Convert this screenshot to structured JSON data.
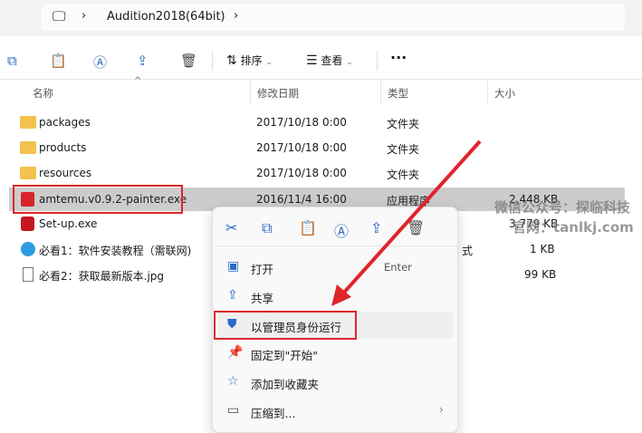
{
  "address": {
    "path": "Audition2018(64bit)"
  },
  "toolbar": {
    "sort": "排序",
    "view": "查看",
    "more": "···"
  },
  "columns": {
    "name": "名称",
    "date": "修改日期",
    "type": "类型",
    "size": "大小"
  },
  "files": [
    {
      "name": "packages",
      "date": "2017/10/18 0:00",
      "type": "文件夹",
      "size": ""
    },
    {
      "name": "products",
      "date": "2017/10/18 0:00",
      "type": "文件夹",
      "size": ""
    },
    {
      "name": "resources",
      "date": "2017/10/18 0:00",
      "type": "文件夹",
      "size": ""
    },
    {
      "name": "amtemu.v0.9.2-painter.exe",
      "date": "2016/11/4 16:00",
      "type": "应用程序",
      "size": "2,448 KB"
    },
    {
      "name": "Set-up.exe",
      "date": "",
      "type": "",
      "size": "3,779 KB"
    },
    {
      "name": "必看1：软件安装教程（需联网)",
      "date": "",
      "type": "式",
      "size": "1 KB"
    },
    {
      "name": "必看2：获取最新版本.jpg",
      "date": "",
      "type": "",
      "size": "99 KB"
    }
  ],
  "context_menu": {
    "items": [
      {
        "label": "打开",
        "shortcut": "Enter"
      },
      {
        "label": "共享"
      },
      {
        "label": "以管理员身份运行"
      },
      {
        "label": "固定到\"开始\""
      },
      {
        "label": "添加到收藏夹"
      },
      {
        "label": "压缩到..."
      }
    ]
  },
  "watermark": {
    "line1": "微信公众号：探临科技",
    "line2": "官网：tanlkj.com"
  }
}
